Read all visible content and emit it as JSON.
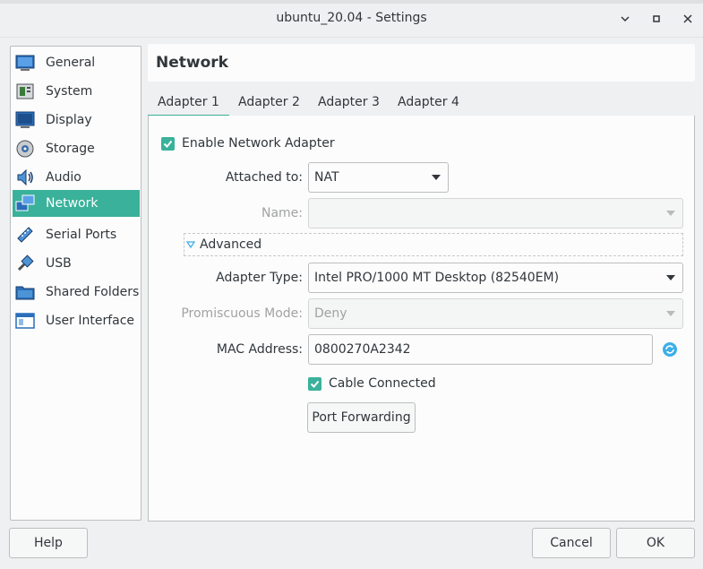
{
  "window": {
    "title": "ubuntu_20.04 - Settings"
  },
  "sidebar": {
    "items": [
      {
        "label": "General",
        "icon": "general-icon",
        "active": false
      },
      {
        "label": "System",
        "icon": "system-icon",
        "active": false
      },
      {
        "label": "Display",
        "icon": "display-icon",
        "active": false
      },
      {
        "label": "Storage",
        "icon": "storage-icon",
        "active": false
      },
      {
        "label": "Audio",
        "icon": "audio-icon",
        "active": false
      },
      {
        "label": "Network",
        "icon": "network-icon",
        "active": true
      },
      {
        "label": "Serial Ports",
        "icon": "serial-ports-icon",
        "active": false
      },
      {
        "label": "USB",
        "icon": "usb-icon",
        "active": false
      },
      {
        "label": "Shared Folders",
        "icon": "shared-folders-icon",
        "active": false
      },
      {
        "label": "User Interface",
        "icon": "user-interface-icon",
        "active": false
      }
    ]
  },
  "page": {
    "title": "Network"
  },
  "tabs": [
    {
      "label": "Adapter 1",
      "active": true
    },
    {
      "label": "Adapter 2",
      "active": false
    },
    {
      "label": "Adapter 3",
      "active": false
    },
    {
      "label": "Adapter 4",
      "active": false
    }
  ],
  "adapter": {
    "enable_label": "Enable Network Adapter",
    "enable_checked": true,
    "attached_label": "Attached to:",
    "attached_value": "NAT",
    "name_label": "Name:",
    "name_value": "",
    "advanced_label": "Advanced",
    "adapter_type_label": "Adapter Type:",
    "adapter_type_value": "Intel PRO/1000 MT Desktop (82540EM)",
    "promiscuous_label": "Promiscuous Mode:",
    "promiscuous_value": "Deny",
    "mac_label": "MAC Address:",
    "mac_value": "0800270A2342",
    "cable_label": "Cable Connected",
    "cable_checked": true,
    "port_forwarding_label": "Port Forwarding"
  },
  "footer": {
    "help_label": "Help",
    "cancel_label": "Cancel",
    "ok_label": "OK"
  },
  "colors": {
    "accent": "#3ab19a",
    "background": "#eff0f1",
    "panel": "#fcfcfc",
    "border": "#bcbebf"
  }
}
